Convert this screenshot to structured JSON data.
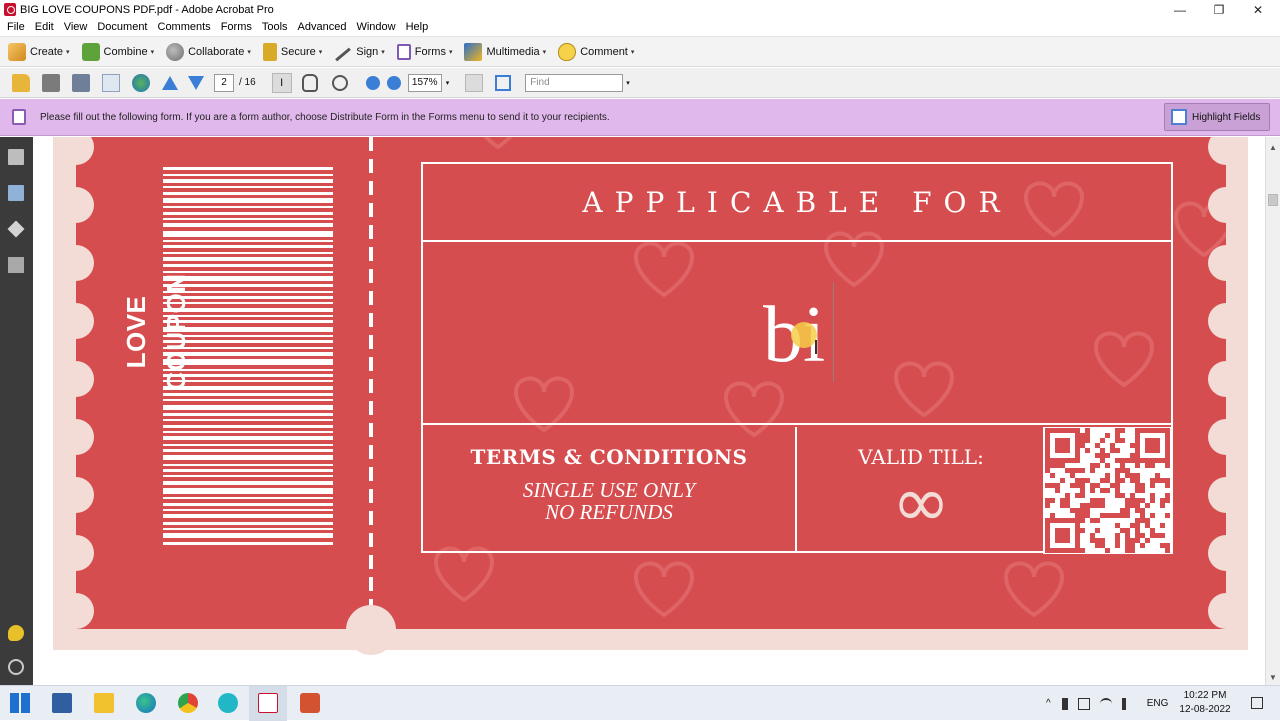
{
  "window": {
    "title": "BIG LOVE COUPONS PDF.pdf - Adobe Acrobat Pro",
    "minimize": "—",
    "maximize": "❐",
    "close": "✕"
  },
  "menubar": {
    "items": [
      "File",
      "Edit",
      "View",
      "Document",
      "Comments",
      "Forms",
      "Tools",
      "Advanced",
      "Window",
      "Help"
    ]
  },
  "toolbar": {
    "create": "Create",
    "combine": "Combine",
    "collaborate": "Collaborate",
    "secure": "Secure",
    "sign": "Sign",
    "forms": "Forms",
    "multimedia": "Multimedia",
    "comment": "Comment",
    "caret": "▾"
  },
  "navigation": {
    "current_page": "2",
    "total_pages": "/ 16",
    "zoom": "157%",
    "find_placeholder": "Find",
    "select_glyph": "I"
  },
  "formbar": {
    "message": "Please fill out the following form. If you are a form author, choose Distribute Form in the Forms menu to send it to your recipients.",
    "highlight_button": "Highlight Fields"
  },
  "coupon": {
    "side_label": "LOVE COUPON",
    "heading": "APPLICABLE FOR",
    "field_value": "bi",
    "terms_title": "TERMS & CONDITIONS",
    "terms_line1": "SINGLE USE ONLY",
    "terms_line2": "NO REFUNDS",
    "valid_title": "VALID TILL:",
    "valid_symbol": "∞",
    "colors": {
      "coupon_red": "#d64d4f",
      "background_pink": "#f4dcd6",
      "form_bar": "#e0b8ec"
    }
  },
  "taskbar": {
    "language": "ENG",
    "time": "10:22 PM",
    "date": "12-08-2022",
    "chevron": "^",
    "icons": [
      "windows-icon",
      "calculator-icon",
      "file-explorer-icon",
      "edge-icon",
      "chrome-icon",
      "canva-icon",
      "acrobat-icon",
      "powerpoint-icon"
    ]
  }
}
